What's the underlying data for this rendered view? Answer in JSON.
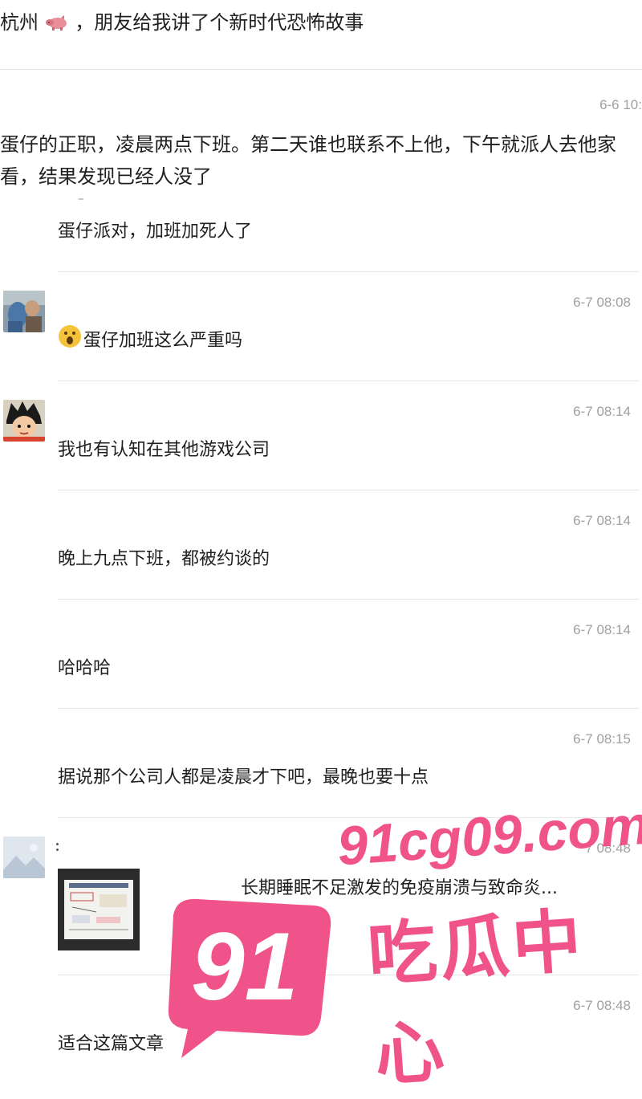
{
  "post": {
    "title_prefix": "杭州",
    "title_suffix": "，朋友给我讲了个新时代恐怖故事",
    "first_time": "6-6 10:",
    "first_body": "蛋仔的正职，凌晨两点下班。第二天谁也联系不上他，下午就派人去他家看，结果发现已经人没了"
  },
  "comments": [
    {
      "text": "蛋仔派对，加班加死人了"
    },
    {
      "time": "6-7 08:08",
      "text": "蛋仔加班这么严重吗"
    },
    {
      "time": "6-7 08:14",
      "text": "我也有认知在其他游戏公司"
    },
    {
      "time": "6-7 08:14",
      "text": "晚上九点下班，都被约谈的"
    },
    {
      "time": "6-7 08:14",
      "text": "哈哈哈"
    },
    {
      "time": "6-7 08:15",
      "text": "据说那个公司人都是凌晨才下吧，最晚也要十点"
    },
    {
      "time": "7 08:48",
      "text": "长期睡眠不足激发的免疫崩溃与致命炎..."
    },
    {
      "time": "6-7 08:48",
      "text": "适合这篇文章"
    }
  ],
  "watermark": {
    "number": "91",
    "domain": "91cg09.com",
    "name": "吃瓜中心"
  },
  "colors": {
    "accent": "#f0528a",
    "timestamp": "#a0a0a0",
    "divider": "#e6e6e6"
  }
}
